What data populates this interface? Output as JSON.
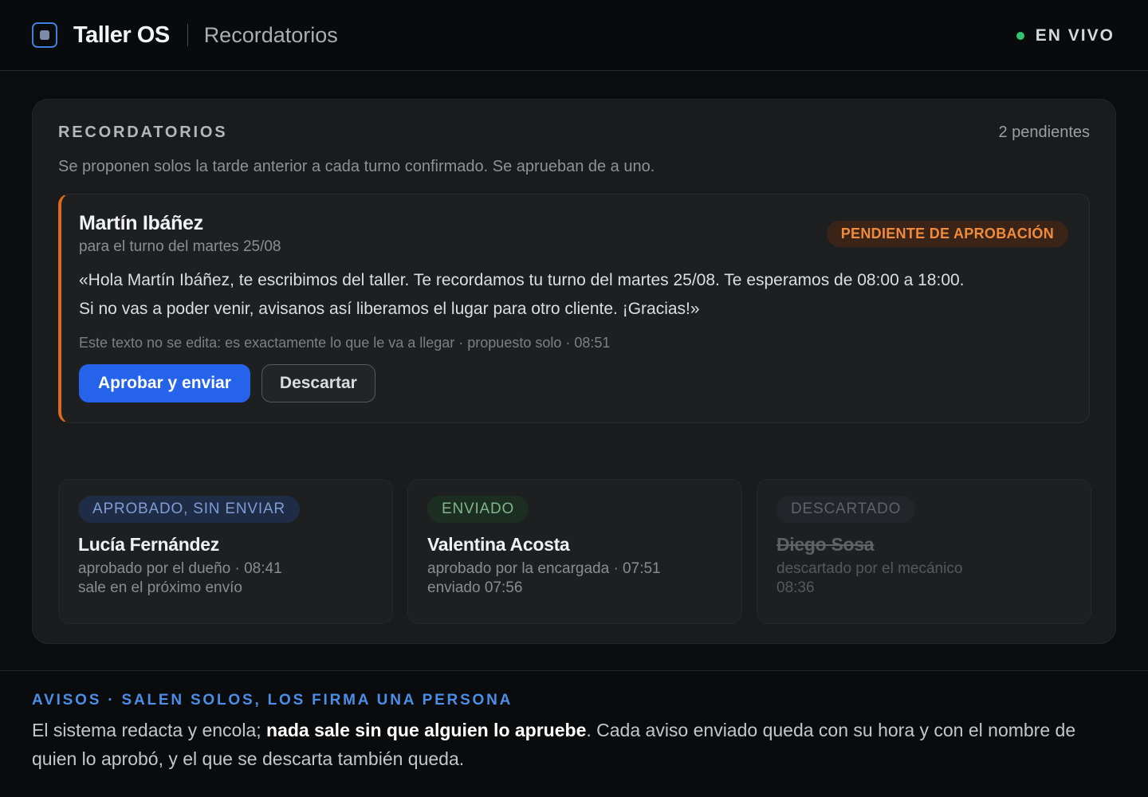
{
  "header": {
    "app_title": "Taller OS",
    "section": "Recordatorios",
    "live_label": "EN VIVO",
    "live_color": "#2fc56a"
  },
  "panel": {
    "title": "RECORDATORIOS",
    "pending_count": "2 pendientes",
    "subtitle": "Se proponen solos la tarde anterior a cada turno confirmado. Se aprueban de a uno."
  },
  "active": {
    "name": "Martín Ibáñez",
    "sub": "para el turno del martes 25/08",
    "status": "PENDIENTE DE APROBACIÓN",
    "message_line1": "«Hola Martín Ibáñez, te escribimos del taller. Te recordamos tu turno del martes 25/08. Te esperamos de 08:00 a 18:00.",
    "message_line2": "Si no vas a poder venir, avisanos así liberamos el lugar para otro cliente. ¡Gracias!»",
    "note": "Este texto no se edita: es exactamente lo que le va a llegar · propuesto solo · 08:51",
    "approve_label": "Aprobar y enviar",
    "discard_label": "Descartar",
    "accent": "#e06a1c"
  },
  "cards": [
    {
      "tag": "APROBADO, SIN ENVIAR",
      "name": "Lucía Fernández",
      "line1": "aprobado por el dueño · 08:41",
      "line2": "sale en el próximo envío"
    },
    {
      "tag": "ENVIADO",
      "name": "Valentina Acosta",
      "line1": "aprobado por la encargada · 07:51",
      "line2": "enviado 07:56"
    },
    {
      "tag": "DESCARTADO",
      "name": "Diego Sosa",
      "line1": "descartado por el mecánico",
      "line2": "08:36"
    }
  ],
  "footer": {
    "title": "AVISOS · SALEN SOLOS, LOS FIRMA UNA PERSONA",
    "text_a": "El sistema redacta y encola; ",
    "text_bold": "nada sale sin que alguien lo apruebe",
    "text_b": ". Cada aviso enviado queda con su hora y con el nombre de quien lo aprobó, y el que se descarta también queda."
  }
}
